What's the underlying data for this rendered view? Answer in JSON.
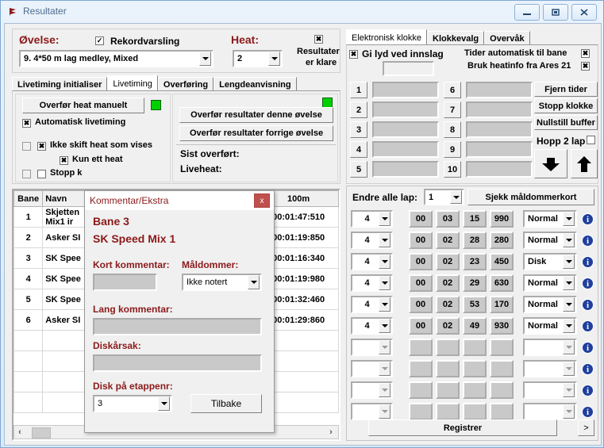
{
  "window": {
    "title": "Resultater",
    "minimize_label": "minimize-icon",
    "maximize_label": "maximize-icon",
    "close_label": "close-icon"
  },
  "left": {
    "ovelse_label": "Øvelse:",
    "rekordvarsling_label": "Rekordvarsling",
    "rekordvarsling_checked": "✓",
    "heat_label": "Heat:",
    "ovelse_value": "9. 4*50 m lag medley, Mixed",
    "heat_value": "2",
    "resultater_klare_check": "✖",
    "resultater_klare_l1": "Resultater",
    "resultater_klare_l2": "er klare",
    "tabs": [
      {
        "label": "Livetiming initialiser",
        "active": false
      },
      {
        "label": "Livetiming",
        "active": true
      },
      {
        "label": "Overføring",
        "active": false
      },
      {
        "label": "Lengdeanvisning",
        "active": false
      }
    ],
    "overfor_heat_manuelt": "Overfør heat manuelt",
    "automatisk_livetiming": "Automatisk livetiming",
    "automatisk_livetiming_check": "✖",
    "ikke_skift_heat": "Ikke skift heat som vises",
    "ikke_skift_heat_check": "✖",
    "kun_ett_heat": "Kun ett heat",
    "kun_ett_heat_check": "✖",
    "stopp_k": "Stopp k",
    "overfor_res_denne": "Overfør resultater denne øvelse",
    "overfor_res_forrige": "Overfør resultater forrige øvelse",
    "sist_overfort": "Sist overført:",
    "liveheat": "Liveheat:"
  },
  "table": {
    "headers": [
      "Bane",
      "Navn",
      "",
      "",
      "",
      "100m"
    ],
    "rows": [
      {
        "bane": "1",
        "navn": "Skjetten SK Mix1 ir",
        "navn_l1": "Skjetten",
        "navn_l2": "Mix1 ir",
        "time": "00:01:47:510"
      },
      {
        "bane": "2",
        "navn": "Asker SK",
        "navn_l1": "Asker SI",
        "navn_l2": "",
        "time": "00:01:19:850"
      },
      {
        "bane": "3",
        "navn": "SK Speed",
        "navn_l1": "SK Spee",
        "navn_l2": "",
        "time": "00:01:16:340"
      },
      {
        "bane": "4",
        "navn": "SK Speed",
        "navn_l1": "SK Spee",
        "navn_l2": "",
        "time": "00:01:19:980"
      },
      {
        "bane": "5",
        "navn": "SK Speed",
        "navn_l1": "SK Spee",
        "navn_l2": "",
        "time": "00:01:32:460"
      },
      {
        "bane": "6",
        "navn": "Asker SK",
        "navn_l1": "Asker SI",
        "navn_l2": "",
        "time": "00:01:29:860"
      },
      {
        "bane": "",
        "navn": "",
        "navn_l1": "",
        "navn_l2": "",
        "time": ""
      },
      {
        "bane": "",
        "navn": "",
        "navn_l1": "",
        "navn_l2": "",
        "time": ""
      },
      {
        "bane": "",
        "navn": "",
        "navn_l1": "",
        "navn_l2": "",
        "time": ""
      },
      {
        "bane": "",
        "navn": "",
        "navn_l1": "",
        "navn_l2": "",
        "time": ""
      }
    ],
    "scroll_left_icon": "‹",
    "scroll_right_icon": "›"
  },
  "dialog": {
    "title": "Kommentar/Ekstra",
    "close_label": "x",
    "bane_label": "Bane  3",
    "lag_label": "SK Speed Mix 1",
    "kort_kommentar_label": "Kort kommentar:",
    "kort_kommentar_value": "",
    "maldommer_label": "Måldommer:",
    "maldommer_value": "Ikke notert",
    "lang_kommentar_label": "Lang kommentar:",
    "lang_kommentar_value": "",
    "diskarsak_label": "Diskårsak:",
    "diskarsak_value": "",
    "disk_etappenr_label": "Disk på etappenr:",
    "disk_etappenr_value": "3",
    "tilbake_label": "Tilbake"
  },
  "right": {
    "tabs": [
      {
        "label": "Elektronisk klokke",
        "active": true
      },
      {
        "label": "Klokkevalg",
        "active": false
      },
      {
        "label": "Overvåk",
        "active": false
      }
    ],
    "gi_lyd_label": "Gi lyd ved innslag",
    "gi_lyd_check": "✖",
    "tider_auto_label": "Tider automatisk til bane",
    "tider_auto_check": "✖",
    "bruk_heatinfo_label": "Bruk heatinfo fra Ares 21",
    "bruk_heatinfo_check": "✖",
    "lane_numbers_left": [
      "1",
      "2",
      "3",
      "4",
      "5"
    ],
    "lane_numbers_right": [
      "6",
      "7",
      "8",
      "9",
      "10"
    ],
    "fjern_tider": "Fjern tider",
    "stopp_klokke": "Stopp klokke",
    "nullstill_buffer": "Nullstill buffer",
    "hopp_2_lap": "Hopp 2 lap",
    "hopp_2_lap_check": "",
    "down_icon": "down-arrow-icon",
    "up_icon": "up-arrow-icon",
    "endre_alle_lap_label": "Endre alle lap:",
    "endre_alle_lap_value": "1",
    "sjekk_maldommerkort": "Sjekk måldommerkort",
    "entry_rows": [
      {
        "lap": "4",
        "h": "00",
        "m": "03",
        "s": "15",
        "ms": "990",
        "status": "Normal",
        "enabled": true
      },
      {
        "lap": "4",
        "h": "00",
        "m": "02",
        "s": "28",
        "ms": "280",
        "status": "Normal",
        "enabled": true
      },
      {
        "lap": "4",
        "h": "00",
        "m": "02",
        "s": "23",
        "ms": "450",
        "status": "Disk",
        "enabled": true
      },
      {
        "lap": "4",
        "h": "00",
        "m": "02",
        "s": "29",
        "ms": "630",
        "status": "Normal",
        "enabled": true
      },
      {
        "lap": "4",
        "h": "00",
        "m": "02",
        "s": "53",
        "ms": "170",
        "status": "Normal",
        "enabled": true
      },
      {
        "lap": "4",
        "h": "00",
        "m": "02",
        "s": "49",
        "ms": "930",
        "status": "Normal",
        "enabled": true
      },
      {
        "lap": "",
        "h": "",
        "m": "",
        "s": "",
        "ms": "",
        "status": "",
        "enabled": false
      },
      {
        "lap": "",
        "h": "",
        "m": "",
        "s": "",
        "ms": "",
        "status": "",
        "enabled": false
      },
      {
        "lap": "",
        "h": "",
        "m": "",
        "s": "",
        "ms": "",
        "status": "",
        "enabled": false
      },
      {
        "lap": "",
        "h": "",
        "m": "",
        "s": "",
        "ms": "",
        "status": "",
        "enabled": false
      }
    ],
    "registrer_label": "Registrer",
    "next_label": ">"
  },
  "colors": {
    "accent_red": "#8b1a1a",
    "dialog_close": "#c0504d",
    "info_blue": "#1f3f9e",
    "green_light": "#00d000",
    "window_chrome": "#dce9f8"
  }
}
